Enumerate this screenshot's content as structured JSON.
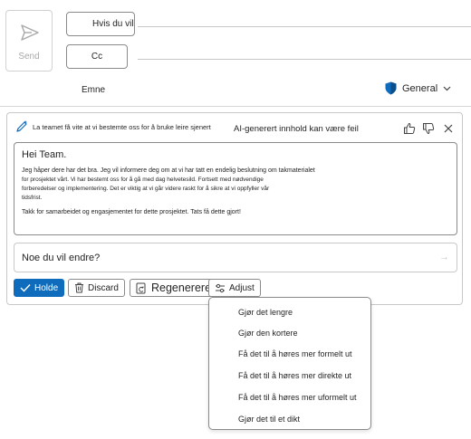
{
  "compose": {
    "send_label": "Send",
    "to_label": "Hvis du vil",
    "cc_label": "Cc",
    "subject_label": "Emne",
    "sensitivity_label": "General"
  },
  "copilot": {
    "prompt_text": "La teamet få vite at vi bestemte oss for å bruke leire sjenert",
    "ai_note": "AI-generert innhold kan være feil",
    "draft": {
      "greeting": "Hei Team.",
      "p1_line1": "Jeg håper dere har det bra. Jeg vil informere deg om at vi har tatt en endelig beslutning om takmaterialet",
      "p1_line2": "for prosjektet vårt. Vi har bestemt oss for å gå med dag helvetesild. Fortsett med nødvendige",
      "p1_line3": "forberedelser og implementering. Det er viktig at vi går videre raskt for å sikre at vi oppfyller vår",
      "p1_line4": "tidsfrist.",
      "p2": "Takk for samarbeidet og engasjementet for dette prosjektet. Tats få dette gjort!"
    },
    "change_placeholder": "Noe du vil endre?",
    "actions": {
      "keep": "Holde",
      "discard": "Discard",
      "regenerate": "Regenerere",
      "adjust": "Adjust"
    },
    "adjust_menu": [
      "Gjør det lengre",
      "Gjør den kortere",
      "Få det til å høres mer formelt ut",
      "Få det til å høres mer direkte ut",
      "Få det til å høres mer uformelt ut",
      "Gjør det til et dikt"
    ]
  },
  "colors": {
    "accent": "#0f6cbd",
    "shield": "#0f6cbd"
  }
}
